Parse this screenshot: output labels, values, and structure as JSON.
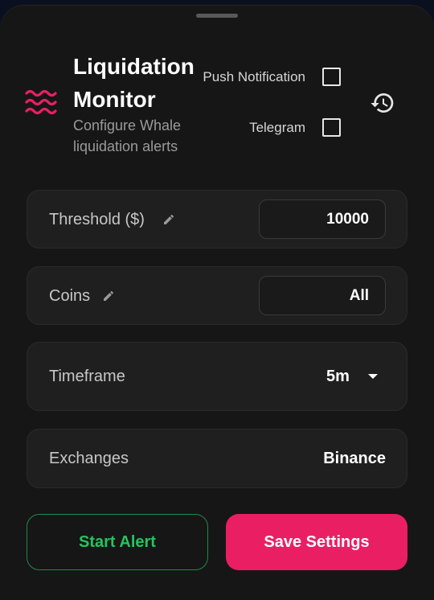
{
  "header": {
    "title_line1": "Liquidation",
    "title_line2": "Monitor",
    "subtitle": "Configure Whale liquidation alerts",
    "logo_icon": "waves-icon",
    "accent_color": "#ea1f63"
  },
  "options": {
    "push_label": "Push Notification",
    "push_checked": false,
    "telegram_label": "Telegram",
    "telegram_checked": false,
    "history_icon": "history-icon"
  },
  "settings": {
    "threshold": {
      "label": "Threshold ($)",
      "value": "10000",
      "edit_icon": "pencil-icon"
    },
    "coins": {
      "label": "Coins",
      "value": "All",
      "edit_icon": "pencil-icon"
    },
    "timeframe": {
      "label": "Timeframe",
      "value": "5m",
      "icon": "chevron-down-icon"
    },
    "exchanges": {
      "label": "Exchanges",
      "value": "Binance"
    }
  },
  "actions": {
    "start_label": "Start Alert",
    "start_color": "#22c55e",
    "save_label": "Save Settings",
    "save_color": "#ea1f63"
  }
}
